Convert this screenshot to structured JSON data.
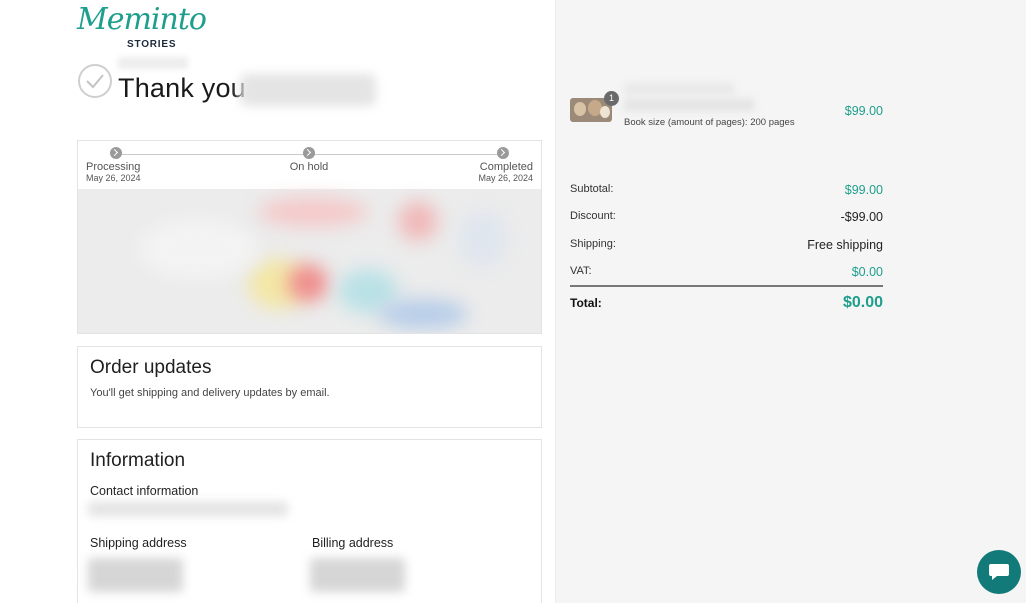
{
  "brand": {
    "logo_script": "Meminto",
    "logo_sub": "STORIES"
  },
  "header": {
    "thanks": "Thank you"
  },
  "status": {
    "steps": [
      {
        "label": "Processing",
        "date": "May 26, 2024"
      },
      {
        "label": "On hold",
        "date": ""
      },
      {
        "label": "Completed",
        "date": "May 26, 2024"
      }
    ]
  },
  "order_updates": {
    "title": "Order updates",
    "text": "You'll get shipping and delivery updates by email."
  },
  "information": {
    "title": "Information",
    "contact_label": "Contact information",
    "shipping_label": "Shipping address",
    "billing_label": "Billing address"
  },
  "summary": {
    "item": {
      "quantity": "1",
      "variant": "Book size (amount of pages): 200 pages",
      "price": "$99.00"
    },
    "subtotal_label": "Subtotal:",
    "subtotal": "$99.00",
    "discount_label": "Discount:",
    "discount": "-$99.00",
    "shipping_label": "Shipping:",
    "shipping": "Free shipping",
    "vat_label": "VAT:",
    "vat": "$0.00",
    "total_label": "Total:",
    "total": "$0.00"
  },
  "colors": {
    "accent": "#1e9e8c",
    "chat": "#127a78"
  },
  "icons": {
    "check": "check-circle-icon",
    "chat": "chat-bubble-icon",
    "step": "chevron-right-icon"
  }
}
